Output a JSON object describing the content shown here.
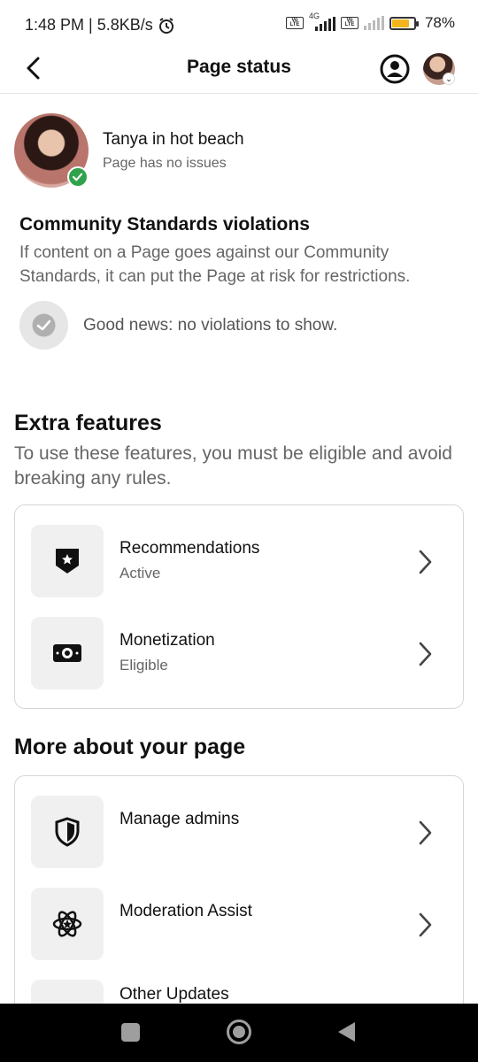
{
  "status_bar": {
    "time_text": "1:48 PM | 5.8KB/s",
    "network_type": "4G",
    "volte_label": "Vo LTE",
    "battery_text": "78%",
    "battery_level": 0.78,
    "icons": [
      "alarm-icon",
      "volte-icon",
      "signal-icon",
      "battery-icon"
    ]
  },
  "header": {
    "title": "Page status",
    "icons": [
      "back-arrow-icon",
      "profile-icon",
      "avatar"
    ]
  },
  "page": {
    "name": "Tanya in hot beach",
    "status": "Page has no issues"
  },
  "community_standards": {
    "title": "Community Standards violations",
    "description": "If content on a Page goes against our Community Standards, it can put the Page at risk for restrictions.",
    "result": "Good news: no violations to show."
  },
  "extra_features": {
    "title": "Extra features",
    "description": "To use these features, you must be eligible and avoid breaking any rules.",
    "items": [
      {
        "label": "Recommendations",
        "status": "Active",
        "icon": "shield-star-icon"
      },
      {
        "label": "Monetization",
        "status": "Eligible",
        "icon": "money-icon"
      }
    ]
  },
  "more_about": {
    "title": "More about your page",
    "items": [
      {
        "label": "Manage admins",
        "icon": "shield-icon"
      },
      {
        "label": "Moderation Assist",
        "icon": "atom-icon"
      },
      {
        "label": "Other Updates",
        "icon": "updates-icon"
      }
    ]
  },
  "colors": {
    "accent_green": "#31a24c",
    "battery_yellow": "#f2b51c",
    "muted_text": "#666666"
  }
}
